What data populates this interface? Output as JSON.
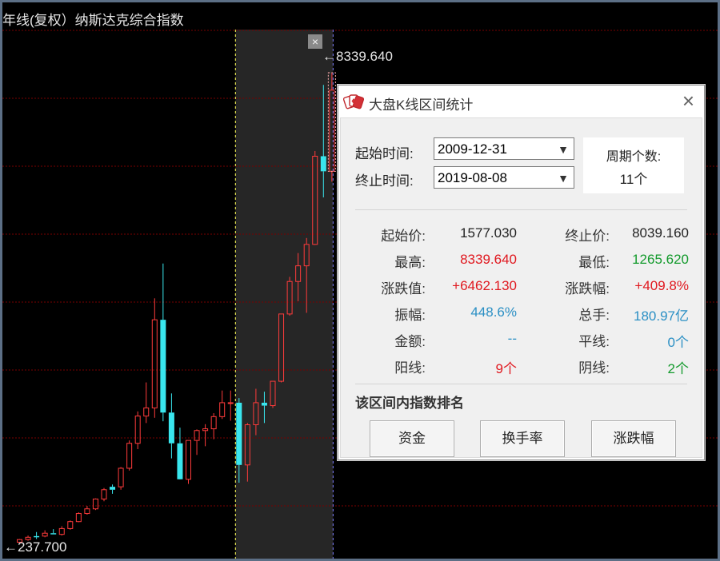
{
  "chart": {
    "title": "年线(复权）纳斯达克综合指数",
    "high_label": "←8339.640",
    "low_label": "←237.700",
    "close_icon": "×",
    "colors": {
      "up": "#ff3b3b",
      "down": "#39e6ee",
      "grid": "#7a0000",
      "range_bg": "#262626",
      "range_start_line": "#ffff55",
      "range_end_line": "#7f7fff"
    }
  },
  "chart_data": {
    "type": "candlestick",
    "title": "年线(复权）纳斯达克综合指数",
    "price_range": [
      237.7,
      8339.64
    ],
    "candles": [
      {
        "o": 245,
        "h": 300,
        "l": 237.7,
        "c": 290,
        "dir": "up"
      },
      {
        "o": 290,
        "h": 360,
        "l": 270,
        "c": 330,
        "dir": "up"
      },
      {
        "o": 330,
        "h": 420,
        "l": 300,
        "c": 350,
        "dir": "down"
      },
      {
        "o": 350,
        "h": 450,
        "l": 330,
        "c": 400,
        "dir": "up"
      },
      {
        "o": 400,
        "h": 470,
        "l": 380,
        "c": 380,
        "dir": "down"
      },
      {
        "o": 380,
        "h": 520,
        "l": 360,
        "c": 480,
        "dir": "up"
      },
      {
        "o": 480,
        "h": 620,
        "l": 460,
        "c": 600,
        "dir": "up"
      },
      {
        "o": 600,
        "h": 760,
        "l": 590,
        "c": 740,
        "dir": "up"
      },
      {
        "o": 740,
        "h": 870,
        "l": 720,
        "c": 820,
        "dir": "up"
      },
      {
        "o": 820,
        "h": 1000,
        "l": 800,
        "c": 990,
        "dir": "up"
      },
      {
        "o": 990,
        "h": 1180,
        "l": 950,
        "c": 1150,
        "dir": "up"
      },
      {
        "o": 1150,
        "h": 1240,
        "l": 1080,
        "c": 1200,
        "dir": "down"
      },
      {
        "o": 1200,
        "h": 1540,
        "l": 1150,
        "c": 1520,
        "dir": "up"
      },
      {
        "o": 1520,
        "h": 2000,
        "l": 1480,
        "c": 1950,
        "dir": "up"
      },
      {
        "o": 1950,
        "h": 2500,
        "l": 1850,
        "c": 2420,
        "dir": "up"
      },
      {
        "o": 2420,
        "h": 3000,
        "l": 2300,
        "c": 2560,
        "dir": "up"
      },
      {
        "o": 2560,
        "h": 4450,
        "l": 2390,
        "c": 4080,
        "dir": "up"
      },
      {
        "o": 4080,
        "h": 5050,
        "l": 2330,
        "c": 2480,
        "dir": "down"
      },
      {
        "o": 2480,
        "h": 2810,
        "l": 1690,
        "c": 1950,
        "dir": "down"
      },
      {
        "o": 1950,
        "h": 2220,
        "l": 1460,
        "c": 1330,
        "dir": "down"
      },
      {
        "o": 1330,
        "h": 2000,
        "l": 1250,
        "c": 2000,
        "dir": "up"
      },
      {
        "o": 2000,
        "h": 2190,
        "l": 1750,
        "c": 2170,
        "dir": "up"
      },
      {
        "o": 2170,
        "h": 2280,
        "l": 1900,
        "c": 2200,
        "dir": "up"
      },
      {
        "o": 2200,
        "h": 2470,
        "l": 2020,
        "c": 2410,
        "dir": "up"
      },
      {
        "o": 2410,
        "h": 2860,
        "l": 2370,
        "c": 2650,
        "dir": "up"
      },
      {
        "o": 2650,
        "h": 2860,
        "l": 2340,
        "c": 2650,
        "dir": "up"
      },
      {
        "o": 2650,
        "h": 2730,
        "l": 1270,
        "c": 1577.03,
        "dir": "down"
      },
      {
        "o": 1577.03,
        "h": 2300,
        "l": 1290,
        "c": 2270,
        "dir": "up"
      },
      {
        "o": 2270,
        "h": 2890,
        "l": 2090,
        "c": 2650,
        "dir": "up"
      },
      {
        "o": 2650,
        "h": 2840,
        "l": 2300,
        "c": 2600,
        "dir": "down"
      },
      {
        "o": 2600,
        "h": 3020,
        "l": 2560,
        "c": 3020,
        "dir": "up"
      },
      {
        "o": 3020,
        "h": 4180,
        "l": 3000,
        "c": 4180,
        "dir": "up"
      },
      {
        "o": 4180,
        "h": 4820,
        "l": 4150,
        "c": 4740,
        "dir": "up"
      },
      {
        "o": 4740,
        "h": 5230,
        "l": 4400,
        "c": 5010,
        "dir": "up"
      },
      {
        "o": 5010,
        "h": 5490,
        "l": 4200,
        "c": 5380,
        "dir": "up"
      },
      {
        "o": 5380,
        "h": 6990,
        "l": 5370,
        "c": 6900,
        "dir": "up"
      },
      {
        "o": 6900,
        "h": 8130,
        "l": 6190,
        "c": 6640,
        "dir": "down"
      },
      {
        "o": 6640,
        "h": 8339.64,
        "l": 6460,
        "c": 8039.16,
        "dir": "up"
      }
    ],
    "range_start_index": 26,
    "range_end_index": 37
  },
  "dialog": {
    "title": "大盘K线区间统计",
    "close_icon": "×",
    "start_label": "起始时间:",
    "end_label": "终止时间:",
    "start_value": "2009-12-31",
    "end_value": "2019-08-08",
    "dropdown_icon": "▼",
    "period_label": "周期个数:",
    "period_value": "11个",
    "stats": {
      "start_price_label": "起始价:",
      "start_price": "1577.030",
      "end_price_label": "终止价:",
      "end_price": "8039.160",
      "high_label": "最高:",
      "high": "8339.640",
      "low_label": "最低:",
      "low": "1265.620",
      "change_label": "涨跌值:",
      "change": "+6462.130",
      "change_pct_label": "涨跌幅:",
      "change_pct": "+409.8%",
      "amplitude_label": "振幅:",
      "amplitude": "448.6%",
      "volume_label": "总手:",
      "volume": "180.97亿",
      "amount_label": "金额:",
      "amount": "--",
      "flat_label": "平线:",
      "flat": "0个",
      "yang_label": "阳线:",
      "yang": "9个",
      "yin_label": "阴线:",
      "yin": "2个"
    },
    "stat_colors": {
      "neutral": "#222222",
      "red": "#e0181f",
      "green": "#139a2c",
      "blue": "#2a8fc4"
    },
    "rank_title": "该区间内指数排名",
    "buttons": {
      "funds": "资金",
      "turnover": "换手率",
      "change": "涨跌幅"
    }
  }
}
